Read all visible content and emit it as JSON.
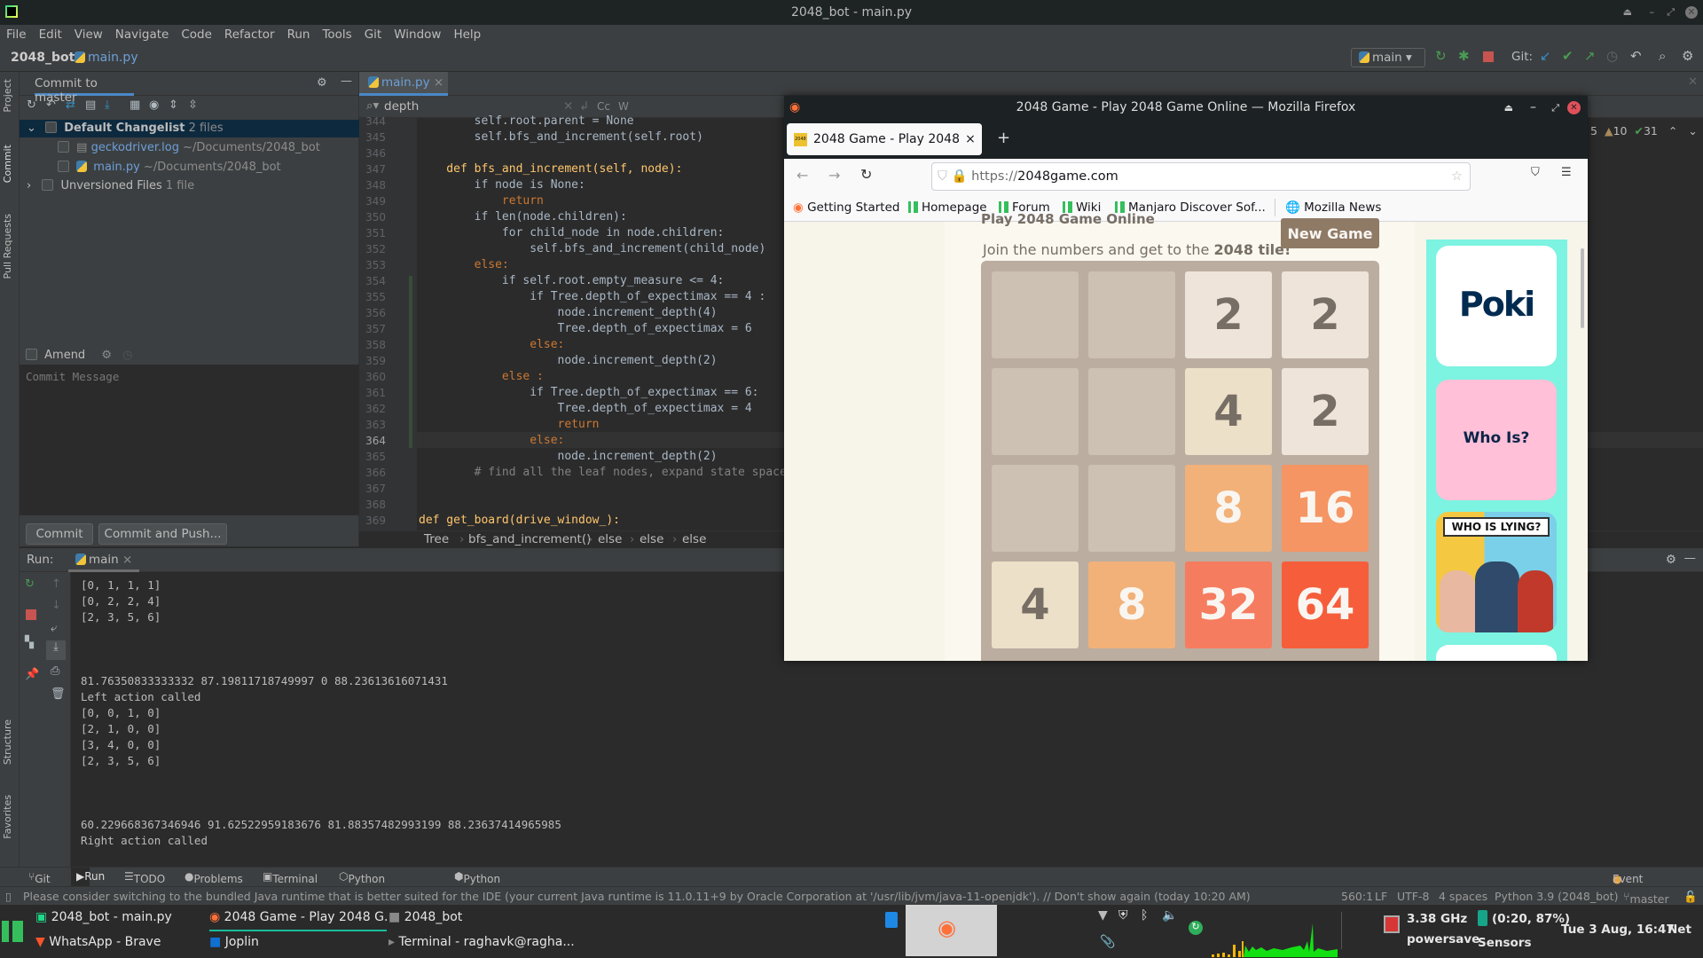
{
  "window": {
    "title": "2048_bot - main.py"
  },
  "menu": [
    "File",
    "Edit",
    "View",
    "Navigate",
    "Code",
    "Refactor",
    "Run",
    "Tools",
    "Git",
    "Window",
    "Help"
  ],
  "nav": {
    "project": "2048_bot",
    "file": "main.py",
    "run_config": "main",
    "git_label": "Git:"
  },
  "left_stripe": {
    "project": "Project",
    "commit": "Commit",
    "pull_requests": "Pull Requests",
    "structure": "Structure",
    "favorites": "Favorites"
  },
  "commit_panel": {
    "title": "Commit to master",
    "changelist": {
      "name": "Default Changelist",
      "count": "2 files"
    },
    "files": [
      {
        "name": "geckodriver.log",
        "path": "~/Documents/2048_bot"
      },
      {
        "name": "main.py",
        "path": "~/Documents/2048_bot"
      }
    ],
    "unversioned": {
      "name": "Unversioned Files",
      "count": "1 file"
    },
    "amend": "Amend",
    "message_placeholder": "Commit Message",
    "commit": "Commit",
    "commit_push": "Commit and Push..."
  },
  "editor": {
    "tab": "main.py",
    "search": "depth",
    "search_opts": [
      "Cc",
      "W"
    ],
    "inspections": {
      "errors": "5",
      "warnings": "10",
      "typos": "31"
    },
    "current_line": 364,
    "lines": [
      {
        "n": 344,
        "text": "        self.root.parent = None"
      },
      {
        "n": 345,
        "text": "        self.bfs_and_increment(self.root)"
      },
      {
        "n": 346,
        "text": ""
      },
      {
        "n": 347,
        "text": "    def bfs_and_increment(self, node):"
      },
      {
        "n": 348,
        "text": "        if node is None:"
      },
      {
        "n": 349,
        "text": "            return"
      },
      {
        "n": 350,
        "text": "        if len(node.children):"
      },
      {
        "n": 351,
        "text": "            for child_node in node.children:"
      },
      {
        "n": 352,
        "text": "                self.bfs_and_increment(child_node)"
      },
      {
        "n": 353,
        "text": "        else:"
      },
      {
        "n": 354,
        "text": "            if self.root.empty_measure <= 4:"
      },
      {
        "n": 355,
        "text": "                if Tree.depth_of_expectimax == 4 :"
      },
      {
        "n": 356,
        "text": "                    node.increment_depth(4)"
      },
      {
        "n": 357,
        "text": "                    Tree.depth_of_expectimax = 6"
      },
      {
        "n": 358,
        "text": "                else:"
      },
      {
        "n": 359,
        "text": "                    node.increment_depth(2)"
      },
      {
        "n": 360,
        "text": "            else :"
      },
      {
        "n": 361,
        "text": "                if Tree.depth_of_expectimax == 6:"
      },
      {
        "n": 362,
        "text": "                    Tree.depth_of_expectimax = 4"
      },
      {
        "n": 363,
        "text": "                    return"
      },
      {
        "n": 364,
        "text": "                else:"
      },
      {
        "n": 365,
        "text": "                    node.increment_depth(2)"
      },
      {
        "n": 366,
        "text": "        # find all the leaf nodes, expand state space tree"
      },
      {
        "n": 367,
        "text": ""
      },
      {
        "n": 368,
        "text": ""
      },
      {
        "n": 369,
        "text": "def get_board(drive_window_):"
      }
    ],
    "breadcrumbs": [
      "Tree",
      "bfs_and_increment()",
      "else",
      "else",
      "else"
    ]
  },
  "run": {
    "label": "Run:",
    "tab": "main",
    "output": [
      "[0, 1, 1, 1]",
      "[0, 2, 2, 4]",
      "[2, 3, 5, 6]",
      "",
      "",
      "",
      "81.76350833333332 87.19811718749997 0 88.23613616071431",
      "Left action called",
      "[0, 0, 1, 0]",
      "[2, 1, 0, 0]",
      "[3, 4, 0, 0]",
      "[2, 3, 5, 6]",
      "",
      "",
      "",
      "60.229668367346946 91.62522959183676 81.88357482993199 88.23637414965985",
      "Right action called"
    ]
  },
  "bottom_tools": [
    "Git",
    "Run",
    "TODO",
    "Problems",
    "Terminal",
    "Python Packages",
    "Python Console",
    "Event Log"
  ],
  "status": {
    "message": "Please consider switching to the bundled Java runtime that is better suited for the IDE (your current Java runtime is 11.0.11+9 by Oracle Corporation at '/usr/lib/jvm/java-11-openjdk'). // Don't show again (today 10:20 AM)",
    "position": "560:1",
    "line_sep": "LF",
    "encoding": "UTF-8",
    "indent": "4 spaces",
    "interpreter": "Python 3.9 (2048_bot)",
    "branch": "master"
  },
  "firefox": {
    "title": "2048 Game - Play 2048 Game Online — Mozilla Firefox",
    "tab": "2048 Game - Play 2048 Game Online",
    "url_prefix": "https://",
    "url_host": "2048game.com",
    "bookmarks": [
      "Getting Started",
      "Homepage",
      "Forum",
      "Wiki",
      "Manjaro Discover Sof...",
      "Mozilla News"
    ],
    "game": {
      "heading": "Play 2048 Game Online",
      "subtitle_pre": "Join the numbers and get to the ",
      "subtitle_bold": "2048 tile!",
      "new_game": "New Game",
      "grid": [
        [
          0,
          0,
          2,
          2
        ],
        [
          0,
          0,
          4,
          2
        ],
        [
          0,
          0,
          8,
          16
        ],
        [
          4,
          8,
          32,
          64
        ]
      ]
    },
    "ads": [
      "Poki",
      "Who Is?",
      "WHO IS LYING?"
    ]
  },
  "taskbar": {
    "windows_row1": [
      "2048_bot - main.py",
      "2048 Game - Play 2048 G...",
      "2048_bot"
    ],
    "windows_row2": [
      "WhatsApp - Brave",
      "Joplin",
      "Terminal - raghavk@ragha..."
    ],
    "cpu_freq": "3.38 GHz",
    "governor": "powersave",
    "battery": "(0:20, 87%)",
    "sensors": "Sensors",
    "clock": "Tue  3 Aug, 16:47",
    "net": "Net"
  },
  "colors": {
    "accent": "#4a88c7",
    "keyword": "#cc7832",
    "search_hit": "#32593d",
    "tile_64": "#f65e3b"
  }
}
